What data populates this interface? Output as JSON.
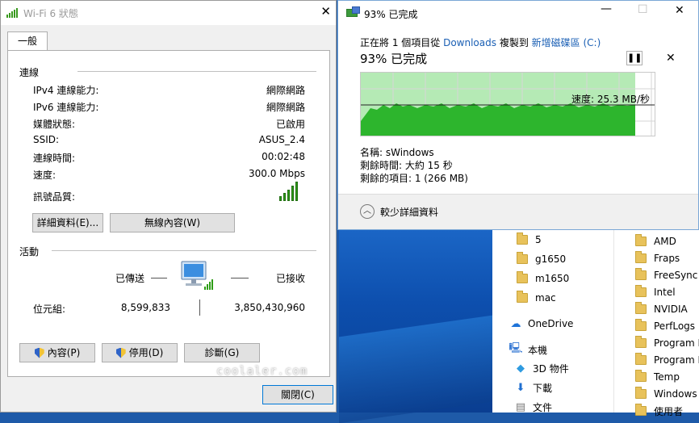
{
  "wifi_window": {
    "title": "Wi-Fi 6 狀態",
    "tab": "一般",
    "connection": {
      "header": "連線",
      "rows": [
        {
          "label": "IPv4 連線能力:",
          "value": "網際網路"
        },
        {
          "label": "IPv6 連線能力:",
          "value": "網際網路"
        },
        {
          "label": "媒體狀態:",
          "value": "已啟用"
        },
        {
          "label": "SSID:",
          "value": "ASUS_2.4"
        },
        {
          "label": "連線時間:",
          "value": "00:02:48"
        },
        {
          "label": "速度:",
          "value": "300.0 Mbps"
        }
      ],
      "signal_label": "訊號品質:",
      "signal_bars": 5,
      "details_button": "詳細資料(E)...",
      "wireless_button": "無線內容(W)"
    },
    "activity": {
      "header": "活動",
      "sent_label": "已傳送",
      "received_label": "已接收",
      "bytes_label": "位元組:",
      "bytes_sent": "8,599,833",
      "bytes_received": "3,850,430,960"
    },
    "buttons": {
      "properties": "內容(P)",
      "disable": "停用(D)",
      "diagnose": "診斷(G)",
      "close": "關閉(C)"
    }
  },
  "copy_window": {
    "title": "93% 已完成",
    "line_prefix": "正在將 1 個項目從",
    "source": "Downloads",
    "line_mid": "複製到",
    "destination": "新增磁碟區 (C:)",
    "progress_text": "93% 已完成",
    "progress_percent": 93,
    "speed": "速度: 25.3 MB/秒",
    "name": "名稱: sWindows",
    "time_left": "剩餘時間: 大約 15 秒",
    "items_left": "剩餘的項目: 1 (266 MB)",
    "less_details": "較少詳細資料",
    "graph_color": "#2db52d"
  },
  "explorer": {
    "mid_items": [
      {
        "type": "folder",
        "label": "5"
      },
      {
        "type": "folder",
        "label": "g1650"
      },
      {
        "type": "folder",
        "label": "m1650"
      },
      {
        "type": "folder",
        "label": "mac"
      },
      {
        "type": "onedrive",
        "label": "OneDrive"
      },
      {
        "type": "pc",
        "label": "本機"
      },
      {
        "type": "3d",
        "label": "3D 物件"
      },
      {
        "type": "download",
        "label": "下載"
      },
      {
        "type": "doc",
        "label": "文件"
      }
    ],
    "right_items": [
      "AMD",
      "Fraps",
      "FreeSync",
      "Intel",
      "NVIDIA",
      "PerfLogs",
      "Program Fi",
      "Program Fi",
      "Temp",
      "Windows",
      "使用者"
    ]
  },
  "watermark": "coolaler.com"
}
